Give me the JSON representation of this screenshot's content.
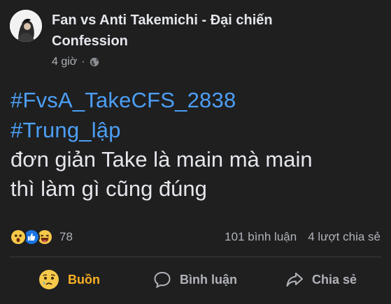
{
  "post": {
    "page_name": "Fan vs Anti Takemichi - Đại chiến Confession",
    "time": "4 giờ",
    "separator": "·",
    "hashtags": [
      "#FvsA_TakeCFS_2838",
      "#Trung_lập"
    ],
    "lines": [
      "đơn giản Take là main mà main",
      "thì làm gì cũng đúng"
    ]
  },
  "stats": {
    "reaction_icons": [
      "wow-reaction-icon",
      "like-reaction-icon",
      "haha-reaction-icon"
    ],
    "reaction_count": "78",
    "comments": "101 bình luận",
    "shares": "4 lượt chia sẻ"
  },
  "actions": {
    "react_label": "Buồn",
    "comment_label": "Bình luận",
    "share_label": "Chia sẻ"
  },
  "colors": {
    "background": "#1f1f20",
    "hashtag": "#4c9ff5",
    "text": "#e4e6eb",
    "muted": "#b0b3b8",
    "sad_reaction": "#f7b125"
  }
}
